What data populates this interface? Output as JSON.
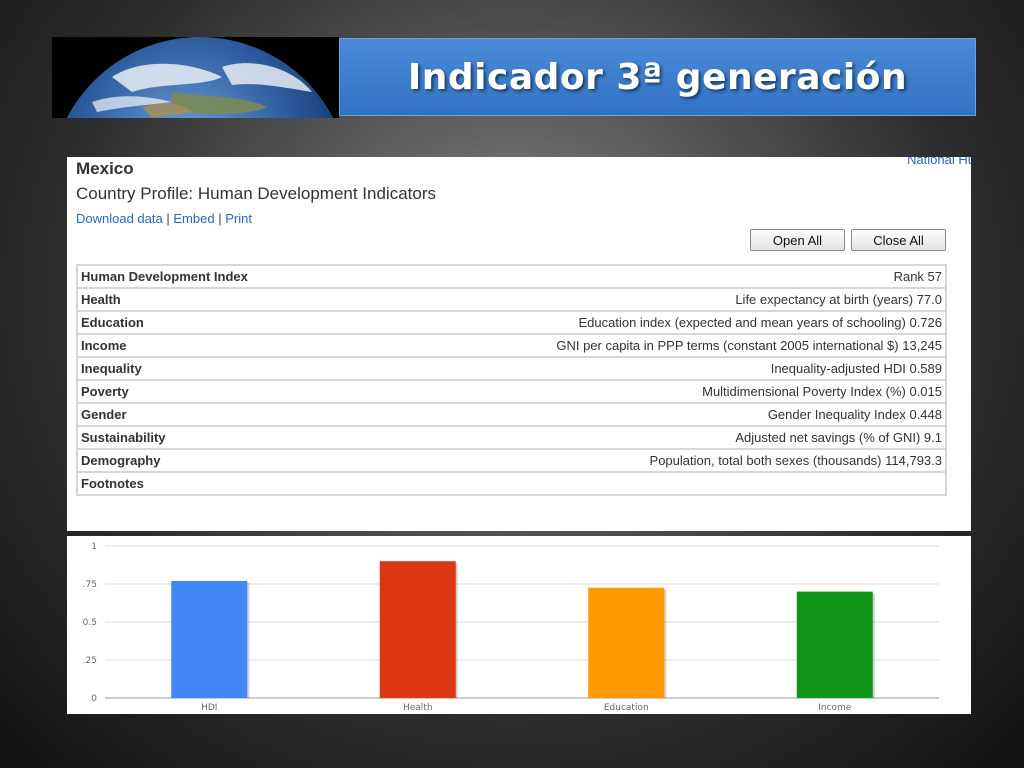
{
  "slide": {
    "title": "Indicador 3ª generación"
  },
  "profile": {
    "corner_link": "National Hu",
    "country": "Mexico",
    "subtitle": "Country Profile: Human Development Indicators",
    "links": {
      "download": "Download data",
      "embed": "Embed",
      "print": "Print",
      "separator": "|"
    },
    "buttons": {
      "open_all": "Open All",
      "close_all": "Close All"
    },
    "rows": [
      {
        "label": "Human Development Index",
        "value": "Rank 57"
      },
      {
        "label": "Health",
        "value": "Life expectancy at birth (years) 77.0"
      },
      {
        "label": "Education",
        "value": "Education index (expected and mean years of schooling) 0.726"
      },
      {
        "label": "Income",
        "value": "GNI per capita in PPP terms (constant 2005 international $) 13,245"
      },
      {
        "label": "Inequality",
        "value": "Inequality-adjusted HDI 0.589"
      },
      {
        "label": "Poverty",
        "value": "Multidimensional Poverty Index (%) 0.015"
      },
      {
        "label": "Gender",
        "value": "Gender Inequality Index 0.448"
      },
      {
        "label": "Sustainability",
        "value": "Adjusted net savings (% of GNI) 9.1"
      },
      {
        "label": "Demography",
        "value": "Population, total both sexes (thousands) 114,793.3"
      },
      {
        "label": "Footnotes",
        "value": ""
      }
    ]
  },
  "chart_data": {
    "type": "bar",
    "categories": [
      "HDI",
      "Health",
      "Education",
      "Income"
    ],
    "values": [
      0.77,
      0.9,
      0.726,
      0.7
    ],
    "colors": [
      "#4285f4",
      "#dc3912",
      "#ff9900",
      "#109618"
    ],
    "ylim": [
      0,
      1
    ],
    "yticks": [
      "0",
      ".25",
      "0.5",
      ".75",
      "1"
    ],
    "grid": true,
    "title": "",
    "xlabel": "",
    "ylabel": ""
  }
}
